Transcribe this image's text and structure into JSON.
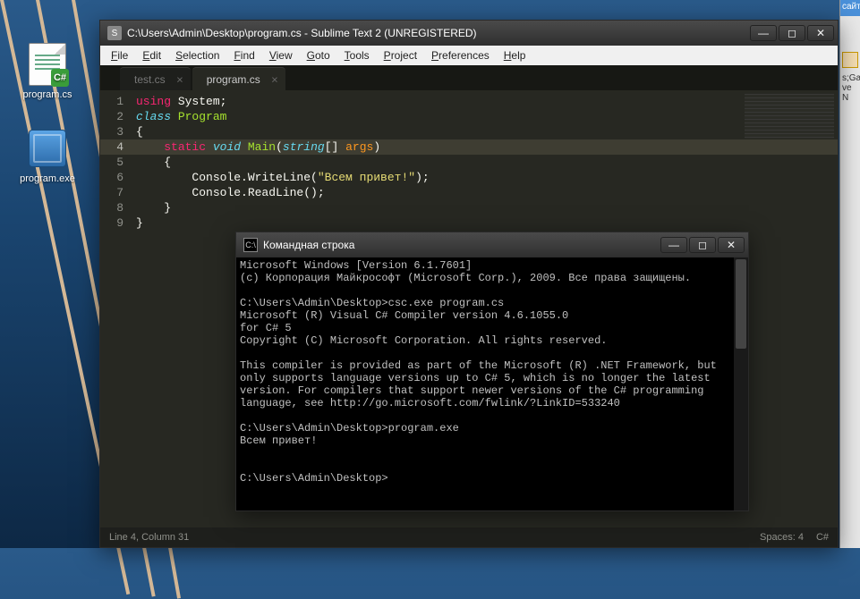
{
  "desktop": {
    "icons": [
      {
        "name": "program.cs",
        "type": "cs"
      },
      {
        "name": "program.exe",
        "type": "exe"
      }
    ]
  },
  "rightStrip": {
    "line1": "сайт",
    "line2": "s;Ga",
    "line3": "ve N"
  },
  "sublime": {
    "title": "C:\\Users\\Admin\\Desktop\\program.cs - Sublime Text 2 (UNREGISTERED)",
    "menu": [
      "File",
      "Edit",
      "Selection",
      "Find",
      "View",
      "Goto",
      "Tools",
      "Project",
      "Preferences",
      "Help"
    ],
    "tabs": [
      {
        "label": "test.cs",
        "active": false
      },
      {
        "label": "program.cs",
        "active": true
      }
    ],
    "code": {
      "lines": [
        {
          "n": 1,
          "tokens": [
            [
              "k-red",
              "using"
            ],
            [
              "k-pun",
              " System;"
            ]
          ]
        },
        {
          "n": 2,
          "tokens": [
            [
              "k-blue",
              "class"
            ],
            [
              "k-pun",
              " "
            ],
            [
              "k-green",
              "Program"
            ]
          ]
        },
        {
          "n": 3,
          "tokens": [
            [
              "k-pun",
              "{"
            ]
          ]
        },
        {
          "n": 4,
          "hl": true,
          "tokens": [
            [
              "k-pun",
              "    "
            ],
            [
              "k-red",
              "static"
            ],
            [
              "k-pun",
              " "
            ],
            [
              "k-blue",
              "void"
            ],
            [
              "k-pun",
              " "
            ],
            [
              "k-green",
              "Main"
            ],
            [
              "k-pun",
              "("
            ],
            [
              "k-blue",
              "string"
            ],
            [
              "k-pun",
              "[] "
            ],
            [
              "k-orange",
              "args"
            ],
            [
              "k-pun",
              ")"
            ]
          ]
        },
        {
          "n": 5,
          "tokens": [
            [
              "k-pun",
              "    {"
            ]
          ]
        },
        {
          "n": 6,
          "tokens": [
            [
              "k-pun",
              "        Console.WriteLine("
            ],
            [
              "k-str",
              "\"Всем привет!\""
            ],
            [
              "k-pun",
              ");"
            ]
          ]
        },
        {
          "n": 7,
          "tokens": [
            [
              "k-pun",
              "        Console.ReadLine();"
            ]
          ]
        },
        {
          "n": 8,
          "tokens": [
            [
              "k-pun",
              "    }"
            ]
          ]
        },
        {
          "n": 9,
          "tokens": [
            [
              "k-pun",
              "}"
            ]
          ]
        }
      ]
    },
    "status": {
      "left": "Line 4, Column 31",
      "spaces": "Spaces: 4",
      "lang": "C#"
    }
  },
  "console": {
    "title": "Командная строка",
    "lines": [
      "Microsoft Windows [Version 6.1.7601]",
      "(c) Корпорация Майкрософт (Microsoft Corp.), 2009. Все права защищены.",
      "",
      "C:\\Users\\Admin\\Desktop>csc.exe program.cs",
      "Microsoft (R) Visual C# Compiler version 4.6.1055.0",
      "for C# 5",
      "Copyright (C) Microsoft Corporation. All rights reserved.",
      "",
      "This compiler is provided as part of the Microsoft (R) .NET Framework, but only supports language versions up to C# 5, which is no longer the latest version. For compilers that support newer versions of the C# programming language, see http://go.microsoft.com/fwlink/?LinkID=533240",
      "",
      "C:\\Users\\Admin\\Desktop>program.exe",
      "Всем привет!",
      "",
      "",
      "C:\\Users\\Admin\\Desktop>"
    ]
  }
}
